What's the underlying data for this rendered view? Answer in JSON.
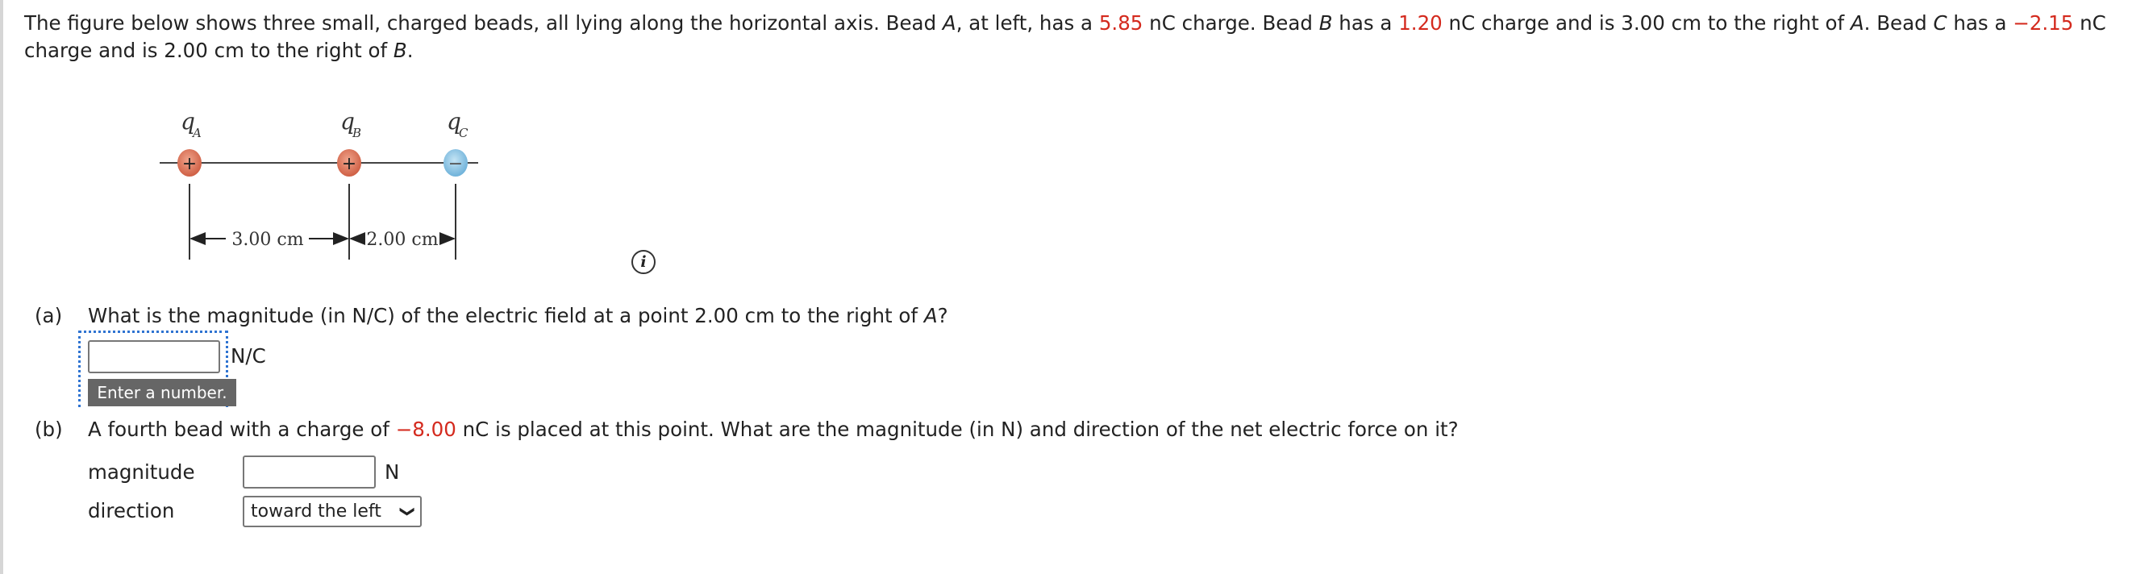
{
  "problem": {
    "intro_parts": [
      "The figure below shows three small, charged beads, all lying along the horizontal axis. Bead ",
      "A",
      ", at left, has a ",
      "5.85",
      " nC charge. Bead ",
      "B",
      " has a ",
      "1.20",
      " nC charge and is 3.00 cm to the right of ",
      "A",
      ". Bead ",
      "C",
      " has a ",
      "−2.15",
      " nC charge and is 2.00 cm to the right of ",
      "B",
      "."
    ]
  },
  "figure": {
    "beads": [
      {
        "label": "q",
        "sub": "A",
        "sign": "+"
      },
      {
        "label": "q",
        "sub": "B",
        "sign": "+"
      },
      {
        "label": "q",
        "sub": "C",
        "sign": "−"
      }
    ],
    "dist_ab": "3.00 cm",
    "dist_bc": "2.00 cm",
    "info_icon": "i",
    "colors": {
      "positive": "#d9735a",
      "negative": "#8cc4e3"
    }
  },
  "part_a": {
    "label": "(a)",
    "question_pre": "What is the magnitude (in N/C) of the electric field at a point 2.00 cm to the right of ",
    "question_var": "A",
    "question_post": "?",
    "input_value": "",
    "unit": "N/C",
    "tooltip": "Enter a number."
  },
  "part_b": {
    "label": "(b)",
    "question_pre": "A fourth bead with a charge of ",
    "charge": "−8.00",
    "question_post": " nC is placed at this point. What are the magnitude (in N) and direction of the net electric force on it?",
    "magnitude_label": "magnitude",
    "magnitude_value": "",
    "magnitude_unit": "N",
    "direction_label": "direction",
    "direction_selected": "toward the left"
  }
}
